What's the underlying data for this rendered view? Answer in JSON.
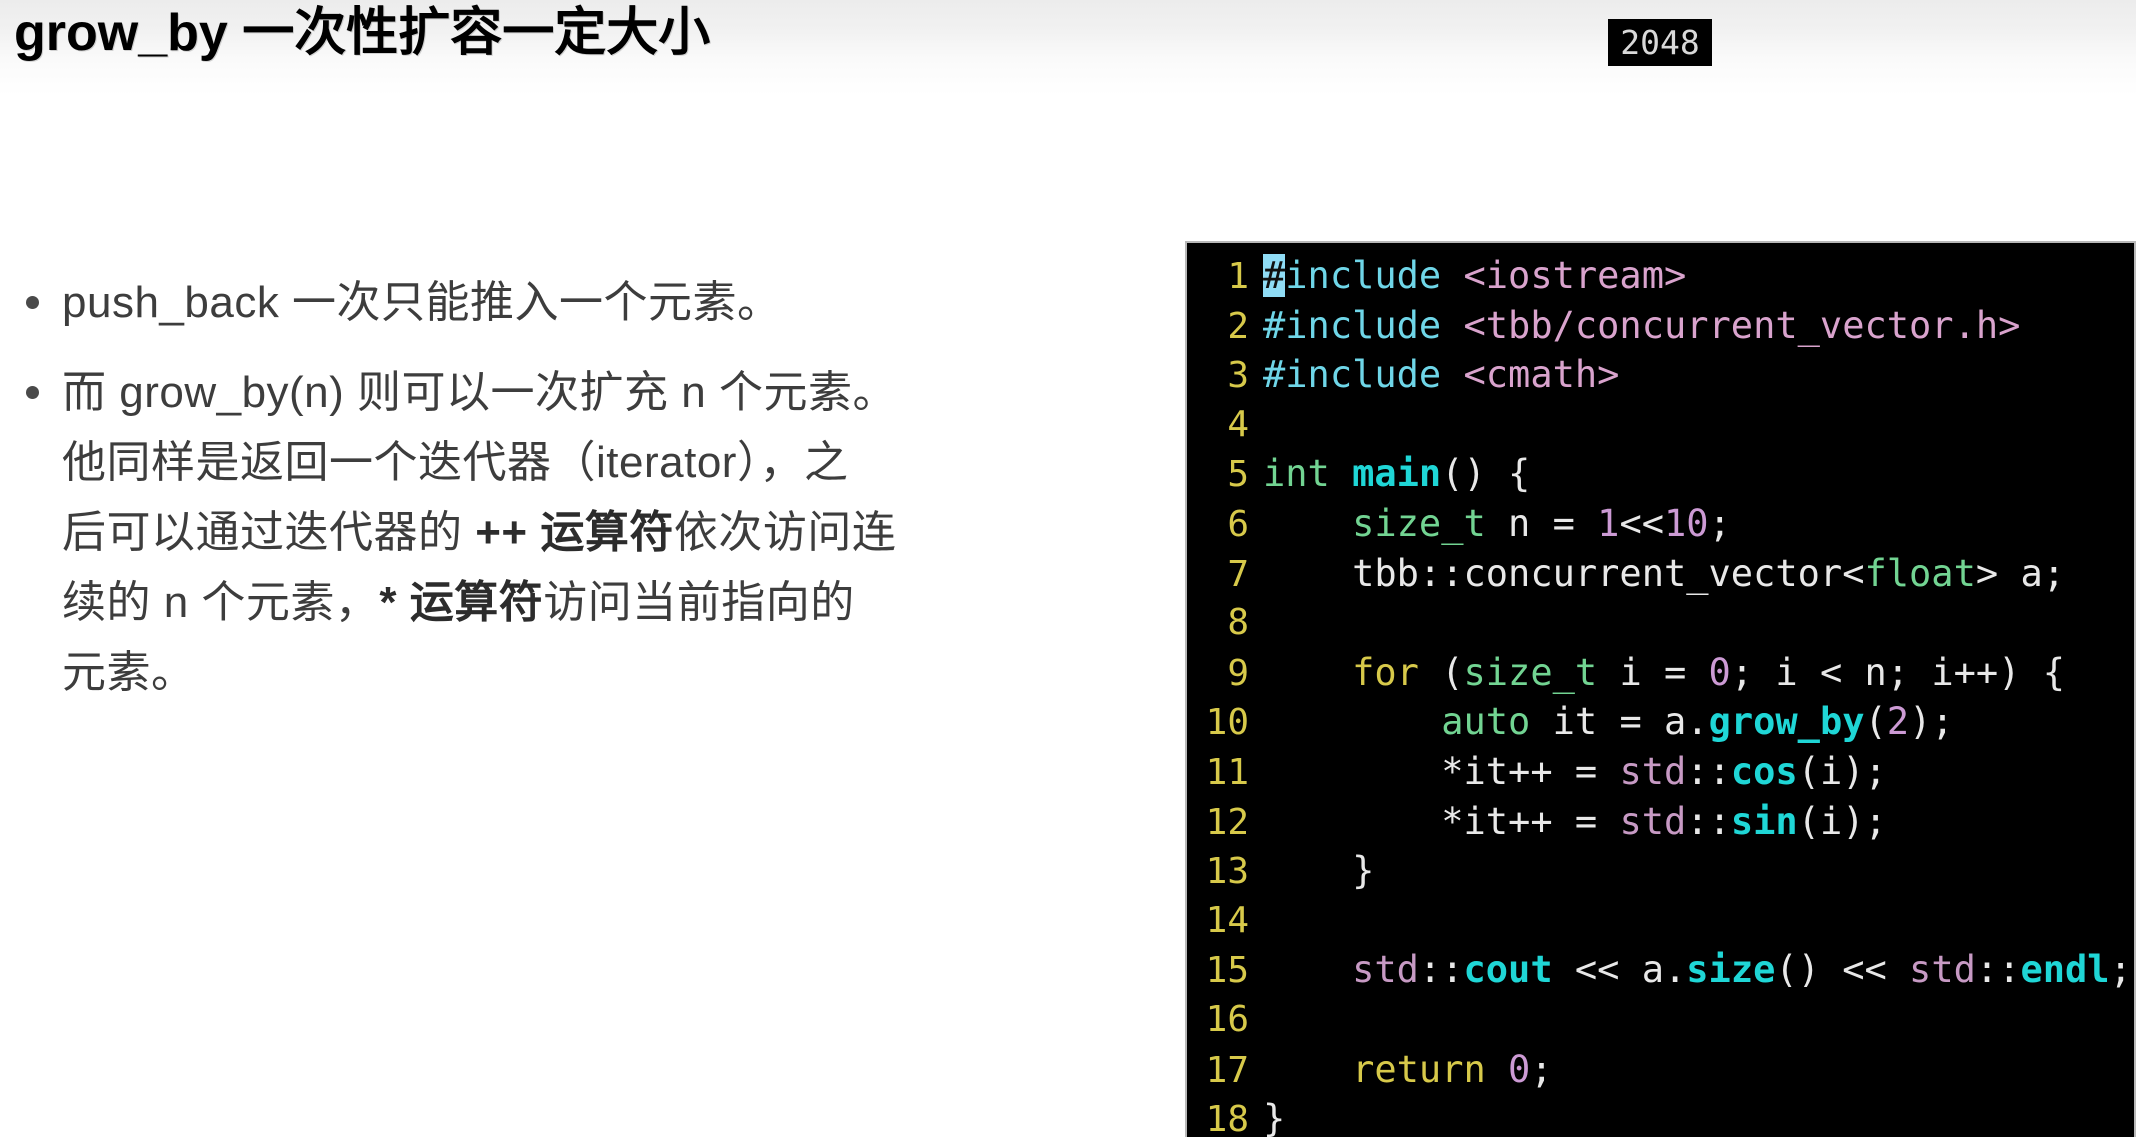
{
  "slide": {
    "title": "grow_by 一次性扩容一定大小",
    "page_badge": "2048",
    "background_color": "#ffffff",
    "title_color": "#000000"
  },
  "bullets": [
    {
      "marker": "bullet-dot",
      "text": "push_back 一次只能推入一个元素。"
    },
    {
      "marker": "bullet-dot",
      "lines": [
        "而 grow_by(n) 则可以一次扩充 n 个元素。",
        "他同样是返回一个迭代器（iterator），之",
        {
          "pre": "后可以通过迭代器的 ",
          "bold": "++ 运算符",
          "post": "依次访问连"
        },
        {
          "pre": "续的 n 个元素，",
          "bold": "* 运算符",
          "post": "访问当前指向的"
        },
        "元素。"
      ]
    }
  ],
  "code": {
    "language": "cpp",
    "background_color": "#000000",
    "line_number_color": "#d7c94a",
    "cursor_color": "#8fdcf5",
    "lines": [
      {
        "n": "1",
        "text": "#include <iostream>"
      },
      {
        "n": "2",
        "text": "#include <tbb/concurrent_vector.h>"
      },
      {
        "n": "3",
        "text": "#include <cmath>"
      },
      {
        "n": "4",
        "text": ""
      },
      {
        "n": "5",
        "text": "int main() {"
      },
      {
        "n": "6",
        "text": "    size_t n = 1<<10;"
      },
      {
        "n": "7",
        "text": "    tbb::concurrent_vector<float> a;"
      },
      {
        "n": "8",
        "text": ""
      },
      {
        "n": "9",
        "text": "    for (size_t i = 0; i < n; i++) {"
      },
      {
        "n": "10",
        "text": "        auto it = a.grow_by(2);"
      },
      {
        "n": "11",
        "text": "        *it++ = std::cos(i);"
      },
      {
        "n": "12",
        "text": "        *it++ = std::sin(i);"
      },
      {
        "n": "13",
        "text": "    }"
      },
      {
        "n": "14",
        "text": ""
      },
      {
        "n": "15",
        "text": "    std::cout << a.size() << std::endl;"
      },
      {
        "n": "16",
        "text": ""
      },
      {
        "n": "17",
        "text": "    return 0;"
      },
      {
        "n": "18",
        "text": "}"
      }
    ]
  }
}
